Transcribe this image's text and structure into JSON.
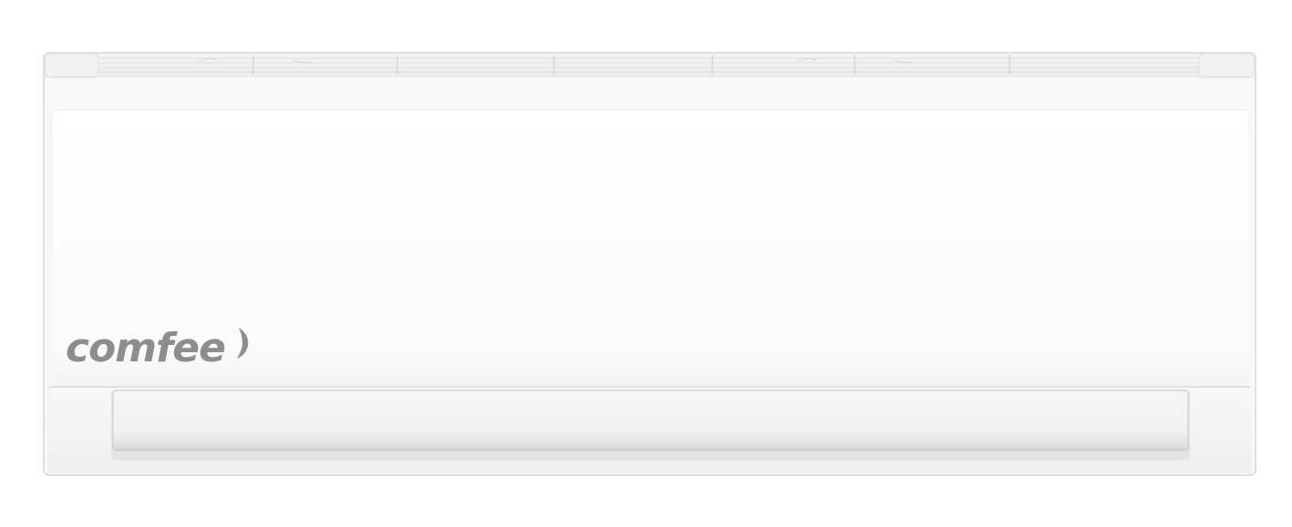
{
  "product": {
    "type": "wall-mounted split air conditioner indoor unit",
    "brand": "comfee",
    "body_color": "#ffffff",
    "logo_color": "#8d8d8d"
  }
}
